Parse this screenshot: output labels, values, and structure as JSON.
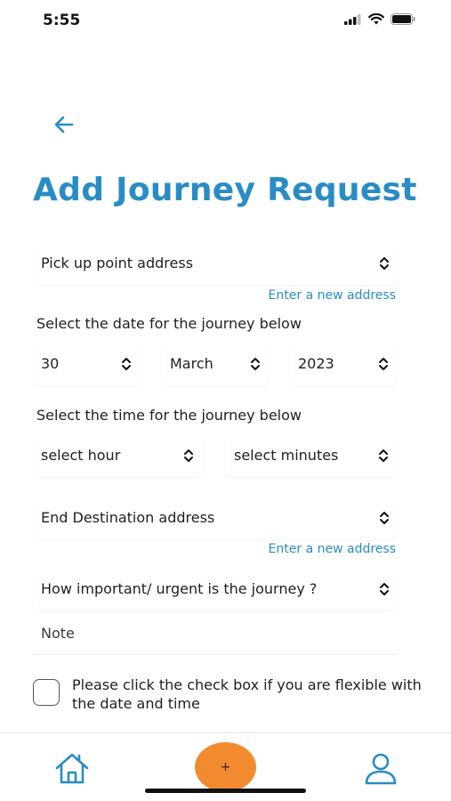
{
  "status": {
    "time": "5:55",
    "icons": [
      "signal-icon",
      "wifi-icon",
      "battery-icon"
    ]
  },
  "header": {
    "back_icon": "arrow-left-icon",
    "title": "Add Journey Request"
  },
  "form": {
    "pickup": {
      "value": "Pick up point address",
      "link": "Enter a new address"
    },
    "date_label": "Select the date for the journey below",
    "date": {
      "day": "30",
      "month": "March",
      "year": "2023"
    },
    "time_label": "Select the time for the journey below",
    "time": {
      "hour": "select hour",
      "minutes": "select minutes"
    },
    "destination": {
      "value": "End Destination address",
      "link": "Enter a new address"
    },
    "urgency": {
      "value": "How important/ urgent is the journey ?"
    },
    "note": {
      "placeholder": "Note",
      "value": ""
    },
    "flexible": {
      "label": "Please click the check box if you are flexible with the date and time",
      "checked": false
    }
  },
  "tab_bar": {
    "home_icon": "home-icon",
    "add_label": "+",
    "profile_icon": "profile-icon"
  },
  "colors": {
    "accent": "#2a8cc4",
    "fab": "#f28b30",
    "text": "#1f1f1f"
  }
}
